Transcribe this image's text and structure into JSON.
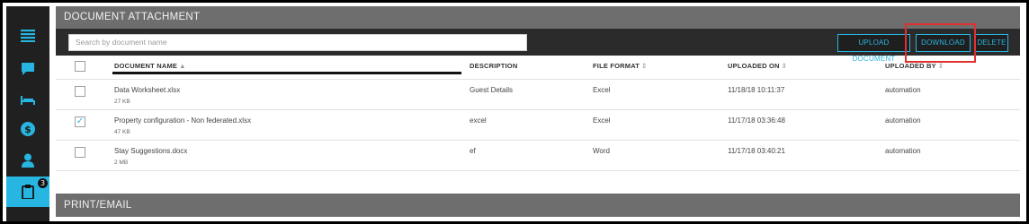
{
  "sections": {
    "attachments_title": "DOCUMENT ATTACHMENT",
    "print_email_title": "PRINT/EMAIL"
  },
  "search": {
    "placeholder": "Search by document name"
  },
  "toolbar": {
    "upload_label": "UPLOAD DOCUMENT",
    "download_label": "DOWNLOAD",
    "delete_label": "DELETE"
  },
  "sidebar": {
    "items": [
      {
        "icon": "list-icon"
      },
      {
        "icon": "chat-icon"
      },
      {
        "icon": "bed-icon"
      },
      {
        "icon": "dollar-icon"
      },
      {
        "icon": "person-icon"
      },
      {
        "icon": "clipboard-icon",
        "active": true,
        "badge": "3"
      }
    ],
    "accent": "#27b6e1"
  },
  "table": {
    "columns": {
      "name": "DOCUMENT NAME",
      "description": "DESCRIPTION",
      "format": "FILE FORMAT",
      "uploaded_on": "UPLOADED ON",
      "uploaded_by": "UPLOADED BY"
    },
    "rows": [
      {
        "name": "Data Worksheet.xlsx",
        "size": "27 KB",
        "description": "Guest Details",
        "format": "Excel",
        "uploaded_on": "11/18/18 10:11:37",
        "uploaded_by": "automation",
        "checked": false
      },
      {
        "name": "Property configuration - Non federated.xlsx",
        "size": "47 KB",
        "description": "excel",
        "format": "Excel",
        "uploaded_on": "11/17/18 03:36:48",
        "uploaded_by": "automation",
        "checked": true
      },
      {
        "name": "Stay Suggestions.docx",
        "size": "2 MB",
        "description": "ef",
        "format": "Word",
        "uploaded_on": "11/17/18 03:40:21",
        "uploaded_by": "automation",
        "checked": false
      }
    ]
  }
}
